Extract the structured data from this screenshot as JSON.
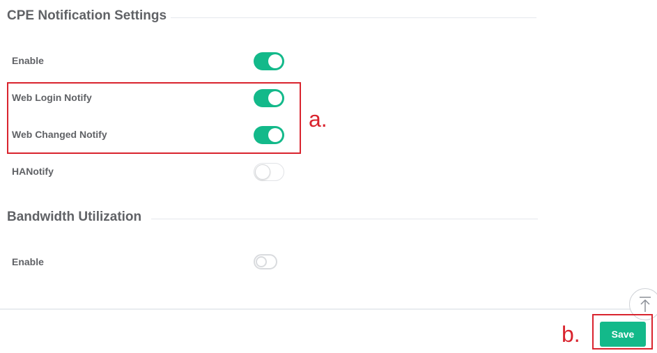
{
  "sections": {
    "cpe": {
      "title": "CPE Notification Settings",
      "rows": [
        {
          "label": "Enable",
          "enabled": true
        },
        {
          "label": "Web Login Notify",
          "enabled": true
        },
        {
          "label": "Web Changed Notify",
          "enabled": true
        },
        {
          "label": "HANotify",
          "enabled": false
        }
      ]
    },
    "bandwidth": {
      "title": "Bandwidth Utilization",
      "rows": [
        {
          "label": "Enable",
          "enabled": false
        }
      ]
    }
  },
  "annotations": {
    "a": "a.",
    "b": "b."
  },
  "footer": {
    "save_label": "Save",
    "scroll_top_icon": "arrow-up-to-line-icon"
  },
  "colors": {
    "accent": "#13b98a",
    "annotation": "#d9232d"
  }
}
